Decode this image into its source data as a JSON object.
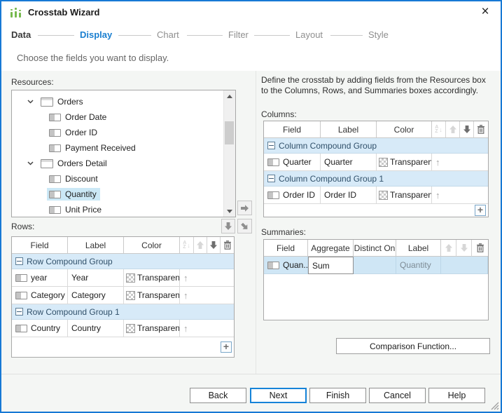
{
  "window": {
    "title": "Crosstab Wizard",
    "close_glyph": "×"
  },
  "steps": {
    "items": [
      {
        "label": "Data"
      },
      {
        "label": "Display"
      },
      {
        "label": "Chart"
      },
      {
        "label": "Filter"
      },
      {
        "label": "Layout"
      },
      {
        "label": "Style"
      }
    ],
    "active": "Display",
    "subtitle": "Choose the fields you want to display."
  },
  "left": {
    "resources_label": "Resources:",
    "tree": {
      "items": [
        {
          "label": "Orders",
          "type": "table",
          "expanded": true
        },
        {
          "label": "Order Date",
          "type": "field"
        },
        {
          "label": "Order ID",
          "type": "field"
        },
        {
          "label": "Payment Received",
          "type": "field"
        },
        {
          "label": "Orders Detail",
          "type": "table",
          "expanded": true
        },
        {
          "label": "Discount",
          "type": "field"
        },
        {
          "label": "Quantity",
          "type": "field",
          "selected": true
        },
        {
          "label": "Unit Price",
          "type": "field"
        }
      ]
    },
    "rows_label": "Rows:"
  },
  "right": {
    "instruction": "Define the crosstab by adding fields from the Resources box to the Columns, Rows, and Summaries boxes accordingly.",
    "columns_label": "Columns:",
    "summaries_label": "Summaries:",
    "comparison_button": "Comparison Function..."
  },
  "columns_table": {
    "headers": {
      "field": "Field",
      "label": "Label",
      "color": "Color"
    },
    "groups": [
      {
        "name": "Column Compound Group",
        "rows": [
          {
            "field": "Quarter",
            "label": "Quarter",
            "color": "Transparent"
          }
        ]
      },
      {
        "name": "Column Compound Group 1",
        "rows": [
          {
            "field": "Order ID",
            "label": "Order ID",
            "color": "Transparent"
          }
        ]
      }
    ]
  },
  "rows_table": {
    "headers": {
      "field": "Field",
      "label": "Label",
      "color": "Color"
    },
    "groups": [
      {
        "name": "Row Compound Group",
        "rows": [
          {
            "field": "year",
            "label": "Year",
            "color": "Transparent"
          },
          {
            "field": "Category",
            "label": "Category",
            "color": "Transparent"
          }
        ]
      },
      {
        "name": "Row Compound Group 1",
        "rows": [
          {
            "field": "Country",
            "label": "Country",
            "color": "Transparent"
          }
        ]
      }
    ]
  },
  "summaries_table": {
    "headers": {
      "field": "Field",
      "aggregate": "Aggregate",
      "distinct_on": "Distinct On",
      "label": "Label"
    },
    "rows": [
      {
        "field": "Quan...",
        "aggregate": "Sum",
        "distinct_on": "",
        "label": "Quantity"
      }
    ]
  },
  "footer": {
    "back": "Back",
    "next": "Next",
    "finish": "Finish",
    "cancel": "Cancel",
    "help": "Help"
  },
  "glyphs": {
    "move_up": "↑",
    "add": "+"
  },
  "colors": {
    "accent": "#1a7fd0",
    "window_border": "#1779d5",
    "group_row_bg": "#d7eaf8",
    "selected_row_bg": "#cfe6f5",
    "tree_selection_bg": "#cbe8f6"
  }
}
